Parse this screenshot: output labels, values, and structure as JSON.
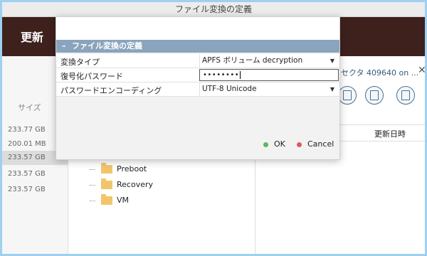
{
  "window": {
    "title": "ファイル変換の定義"
  },
  "toolbar": {
    "label": "更新"
  },
  "size_column": {
    "header": "サイズ",
    "items": [
      "233.77 GB",
      "200.01 MB",
      "233.57 GB",
      "233.57 GB",
      "233.57 GB"
    ],
    "selected_index": 2
  },
  "tree": {
    "items": [
      {
        "label": "Preboot",
        "icon": "folder-icon"
      },
      {
        "label": "Recovery",
        "icon": "folder-icon"
      },
      {
        "label": "VM",
        "icon": "folder-icon"
      }
    ]
  },
  "right_panel": {
    "sector_label": "セクタ 409640 on ...",
    "close_symbol": "✕",
    "toolbar_icons": [
      "document-icon",
      "document-x-icon",
      "document-settings-icon"
    ],
    "column_header": "更新日時"
  },
  "dialog": {
    "section_toggle": "–",
    "section_title": "ファイル変換の定義",
    "rows": [
      {
        "label": "変換タイプ",
        "value": "APFS ボリューム decryption",
        "dropdown": true
      },
      {
        "label": "復号化パスワード",
        "value": "••••••••",
        "masked": true
      },
      {
        "label": "パスワードエンコーディング",
        "value": "UTF-8 Unicode",
        "dropdown": true
      }
    ],
    "dropdown_arrow": "▼",
    "ok_label": "OK",
    "cancel_label": "Cancel",
    "colors": {
      "ok": "#5cb85c",
      "cancel": "#e05a5a",
      "section_header": "#8aa4bd"
    }
  }
}
